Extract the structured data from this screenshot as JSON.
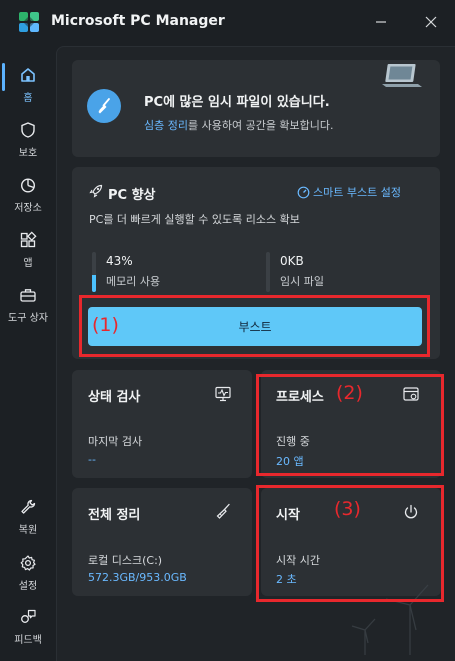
{
  "app": {
    "title": "Microsoft PC Manager"
  },
  "sidebar": {
    "items": [
      {
        "label": "홈",
        "icon": "home-icon"
      },
      {
        "label": "보호",
        "icon": "shield-icon"
      },
      {
        "label": "저장소",
        "icon": "storage-pie-icon"
      },
      {
        "label": "앱",
        "icon": "apps-grid-icon"
      },
      {
        "label": "도구 상자",
        "icon": "toolbox-icon"
      }
    ],
    "bottom": [
      {
        "label": "복원",
        "icon": "wrench-icon"
      },
      {
        "label": "설정",
        "icon": "gear-icon"
      },
      {
        "label": "피드백",
        "icon": "feedback-icon"
      }
    ]
  },
  "banner": {
    "title": "PC에 많은 임시 파일이 있습니다.",
    "link": "심층 정리",
    "rest": "를 사용하여 공간을 확보합니다."
  },
  "boost": {
    "title": "PC 향상",
    "smart_link": "스마트 부스트 설정",
    "desc": "PC를 더 빠르게 실행할 수 있도록 리소스 확보",
    "memory_value": "43%",
    "memory_fraction": 0.43,
    "memory_label": "메모리 사용",
    "temp_value": "0KB",
    "temp_fraction": 0,
    "temp_label": "임시 파일",
    "button": "부스트"
  },
  "tiles": {
    "health": {
      "title": "상태 검사",
      "sub": "마지막 검사",
      "value": "--"
    },
    "process": {
      "title": "프로세스",
      "sub": "진행 중",
      "value": "20 앱"
    },
    "cleanup": {
      "title": "전체 정리",
      "sub": "로컬 디스크(C:)",
      "value": "572.3GB/953.0GB"
    },
    "startup": {
      "title": "시작",
      "sub": "시작 시간",
      "value": "2 초"
    }
  },
  "annotations": {
    "a1": "(1)",
    "a2": "(2)",
    "a3": "(3)"
  },
  "colors": {
    "accent": "#5fc8f8",
    "link": "#6ab9ff",
    "annotation": "#e8282d",
    "background": "#1c2024",
    "card": "#2c3034"
  }
}
